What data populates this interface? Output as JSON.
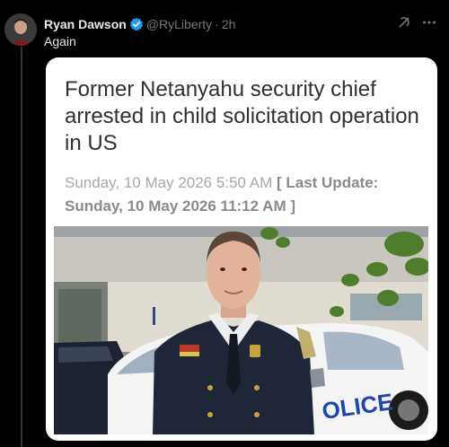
{
  "tweet": {
    "author_name": "Ryan Dawson",
    "handle": "@RyLiberty",
    "separator": "·",
    "time": "2h",
    "text": "Again"
  },
  "card": {
    "headline": "Former Netanyahu security chief arrested in child solicitation operation in US",
    "date": "Sunday, 10 May 2026 5:50 AM",
    "last_update": "[ Last Update: Sunday, 10 May 2026 11:12 AM ]"
  },
  "photo": {
    "car_text": "OLICE"
  },
  "icons": [
    "avatar",
    "verified-badge-icon",
    "grok-icon",
    "more-icon"
  ],
  "colors": {
    "background": "#000000",
    "verified": "#1d9bf0",
    "secondary_text": "#71767b",
    "headline": "#303030"
  }
}
